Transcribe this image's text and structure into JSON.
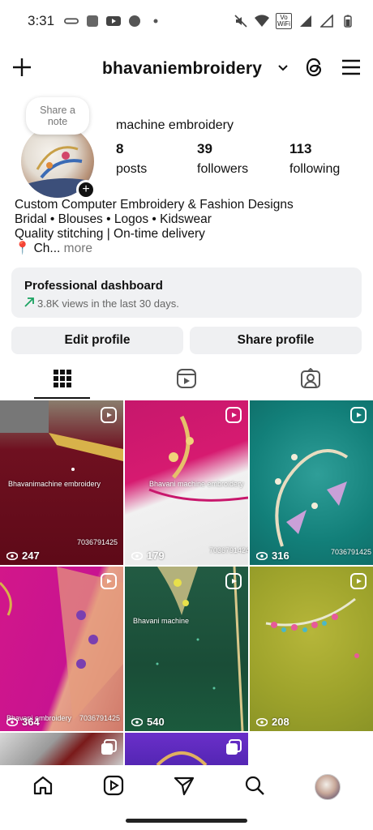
{
  "status_bar": {
    "time": "3:31",
    "wifi_badge": "Vo WiFi"
  },
  "header": {
    "username": "bhavaniembroidery"
  },
  "profile": {
    "note_line1": "Share a",
    "note_line2": "note",
    "name": "machine embroidery",
    "stats": [
      {
        "num": "8",
        "label": "posts"
      },
      {
        "num": "39",
        "label": "followers"
      },
      {
        "num": "113",
        "label": "following"
      }
    ],
    "bio_lines": [
      "Custom Computer Embroidery & Fashion Designs",
      "Bridal • Blouses • Logos • Kidswear",
      "Quality stitching | On-time delivery"
    ],
    "bio_location": "📍 Ch...",
    "bio_more": "more"
  },
  "dashboard": {
    "title": "Professional dashboard",
    "subtitle": "3.8K views in the last 30 days."
  },
  "buttons": {
    "edit": "Edit profile",
    "share": "Share profile"
  },
  "grid": [
    {
      "views": "247",
      "wm1": "Bhavanimachine embroidery",
      "wm2": "7036791425"
    },
    {
      "views": "179",
      "wm1": "Bhavani machine embroidery",
      "wm2": "7036791424"
    },
    {
      "views": "316",
      "wm1": "",
      "wm2": "7036791425"
    },
    {
      "views": "364",
      "wm1": "Bhavani embroidery",
      "wm2": "7036791425"
    },
    {
      "views": "540",
      "wm1": "Bhavani machine",
      "wm2": ""
    },
    {
      "views": "208",
      "wm1": "",
      "wm2": ""
    }
  ],
  "colors": {
    "accent_green": "#1aa260",
    "button_bg": "#eff0f2"
  },
  "icons": {
    "header": [
      "plus-icon",
      "chevron-down-icon",
      "threads-icon",
      "menu-icon"
    ],
    "tabs": [
      "grid-icon",
      "reels-icon",
      "tagged-icon"
    ],
    "nav": [
      "home-icon",
      "reels-icon",
      "send-icon",
      "search-icon",
      "profile-avatar"
    ]
  }
}
